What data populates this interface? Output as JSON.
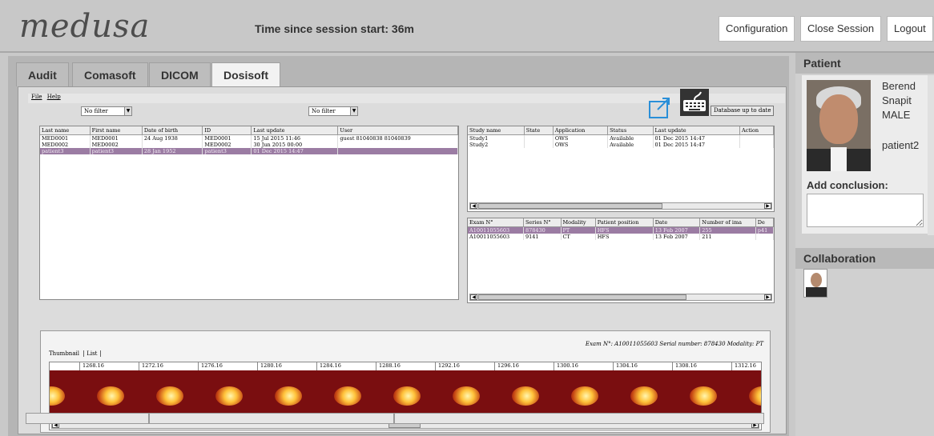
{
  "header": {
    "logo": "medusa",
    "session_time": "Time since session start: 36m",
    "buttons": {
      "configuration": "Configuration",
      "close_session": "Close Session",
      "logout": "Logout"
    }
  },
  "tabs": [
    {
      "label": "Audit"
    },
    {
      "label": "Comasoft"
    },
    {
      "label": "DICOM"
    },
    {
      "label": "Dosisoft",
      "active": true
    }
  ],
  "app": {
    "menu": {
      "file": "File",
      "help": "Help"
    },
    "filter_left": "No filter",
    "filter_right": "No filter",
    "db_button": "Database up to date",
    "patients": {
      "headers": [
        "Last name",
        "First name",
        "Date of birth",
        "ID",
        "Last update",
        "User"
      ],
      "rows": [
        [
          "MED0001",
          "MED0001",
          "24 Aug 1938",
          "MED0001",
          "15 Jul 2015 11:46",
          "guest 81040838 81040839"
        ],
        [
          "MED0002",
          "MED0002",
          "",
          "MED0002",
          "30 Jun 2015 00:00",
          ""
        ],
        [
          "patient3",
          "patient3",
          "28 Jan 1952",
          "patient3",
          "01 Dec 2015 14:47",
          ""
        ]
      ],
      "selected": 2
    },
    "studies": {
      "headers": [
        "Study name",
        "State",
        "Application",
        "Status",
        "Last update",
        "Action"
      ],
      "rows": [
        [
          "Study1",
          "",
          "OWS",
          "Available",
          "01 Dec 2015 14:47",
          ""
        ],
        [
          "Study2",
          "",
          "OWS",
          "Available",
          "01 Dec 2015 14:47",
          ""
        ]
      ]
    },
    "exams": {
      "headers": [
        "Exam N°",
        "Series N°",
        "Modality",
        "Patient position",
        "Date",
        "Number of ima",
        "De"
      ],
      "rows": [
        [
          "A10011055603",
          "878430",
          "PT",
          "HFS",
          "13 Feb 2007",
          "255",
          "p41"
        ],
        [
          "A10011055603",
          "9141",
          "CT",
          "HFS",
          "13 Feb 2007",
          "211",
          ""
        ]
      ],
      "selected": 0
    },
    "thumbnails": {
      "info": "Exam N°: A10011055603  Serial number: 878430  Modality: PT",
      "tab_thumbnail": "Thumbnail",
      "tab_list": "List",
      "labels": [
        "1268.16",
        "1272.16",
        "1276.16",
        "1280.16",
        "1284.16",
        "1288.16",
        "1292.16",
        "1296.16",
        "1300.16",
        "1304.16",
        "1308.16",
        "1312.16"
      ]
    }
  },
  "sidebar": {
    "patient_title": "Patient",
    "first_name": "Berend",
    "last_name": "Snapit",
    "sex": "MALE",
    "patient_id": "patient2",
    "conclusion_label": "Add conclusion:",
    "collaboration_title": "Collaboration"
  },
  "colors": {
    "selected_row": "#9b7ca3",
    "pet_background": "#7a0e10",
    "accent_blue": "#2a8fd8"
  }
}
